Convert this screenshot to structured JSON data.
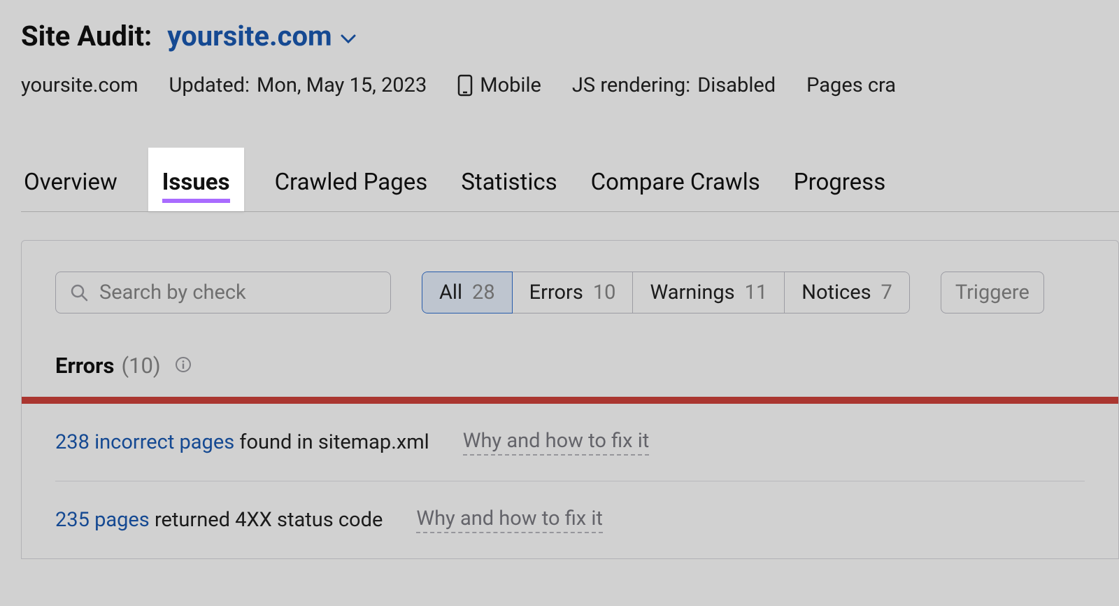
{
  "header": {
    "title_label": "Site Audit:",
    "domain": "yoursite.com"
  },
  "meta": {
    "site": "yoursite.com",
    "updated_label": "Updated:",
    "updated_value": "Mon, May 15, 2023",
    "device": "Mobile",
    "js_label": "JS rendering:",
    "js_value": "Disabled",
    "pages_crawled_label": "Pages cra"
  },
  "tabs": {
    "overview": "Overview",
    "issues": "Issues",
    "crawled_pages": "Crawled Pages",
    "statistics": "Statistics",
    "compare_crawls": "Compare Crawls",
    "progress": "Progress"
  },
  "filters": {
    "search_placeholder": "Search by check",
    "pills": [
      {
        "label": "All",
        "count": "28"
      },
      {
        "label": "Errors",
        "count": "10"
      },
      {
        "label": "Warnings",
        "count": "11"
      },
      {
        "label": "Notices",
        "count": "7"
      }
    ],
    "triggered_label": "Triggere"
  },
  "errors_section": {
    "title": "Errors",
    "count_display": "(10)"
  },
  "issues": [
    {
      "link": "238 incorrect pages",
      "text": "found in sitemap.xml",
      "fix": "Why and how to fix it"
    },
    {
      "link": "235 pages",
      "text": "returned 4XX status code",
      "fix": "Why and how to fix it"
    }
  ]
}
